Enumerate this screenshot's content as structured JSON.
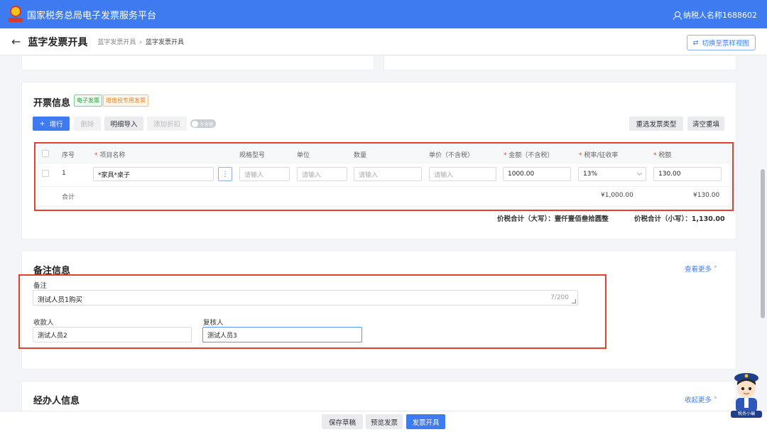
{
  "topbar": {
    "title": "国家税务总局电子发票服务平台",
    "user": "纳税人名称1688602"
  },
  "subheader": {
    "page_title": "蓝字发票开具",
    "breadcrumb": [
      "蓝字发票开具",
      "蓝字发票开具"
    ],
    "switch_view": "切换至票样视图"
  },
  "invoice_info": {
    "title": "开票信息",
    "tags": [
      "电子发票",
      "增值税专用发票"
    ],
    "toolbar": {
      "add_row": "增行",
      "delete": "删除",
      "import_detail": "明细导入",
      "add_discount": "添加折扣",
      "toggle_label": "不含税",
      "reselect_type": "重选发票类型",
      "clear_refill": "清空重填"
    },
    "columns": {
      "index": "序号",
      "item_name": "项目名称",
      "spec": "规格型号",
      "unit": "单位",
      "quantity": "数量",
      "unit_price": "单价（不含税）",
      "amount": "金额（不含税）",
      "tax_rate": "税率/征收率",
      "tax": "税额"
    },
    "row": {
      "index": "1",
      "item_name": "*家具*桌子",
      "spec_placeholder": "请输入",
      "unit_placeholder": "请输入",
      "quantity_placeholder": "请输入",
      "price_placeholder": "请输入",
      "amount": "1000.00",
      "tax_rate": "13%",
      "tax": "130.00"
    },
    "total": {
      "label": "合计",
      "amount": "¥1,000.00",
      "tax": "¥130.00"
    },
    "grand_total": {
      "upper_label": "价税合计（大写）：",
      "upper_value": "壹仟壹佰叁拾圆整",
      "lower_label": "价税合计（小写）：",
      "lower_value": "1,130.00"
    }
  },
  "remarks": {
    "title": "备注信息",
    "view_more": "查看更多",
    "remark_label": "备注",
    "remark_value": "测试人员1购买",
    "remark_counter": "7/200",
    "payee_label": "收款人",
    "payee_value": "测试人员2",
    "reviewer_label": "复核人",
    "reviewer_value": "测试人员3"
  },
  "handler": {
    "title": "经办人信息",
    "collapse": "收起更多"
  },
  "bottom": {
    "save_draft": "保存草稿",
    "preview": "预览发票",
    "issue": "发票开具"
  },
  "mascot_caption": "税务小编",
  "colors": {
    "primary": "#3f7bf0",
    "highlight": "#e3412d"
  }
}
